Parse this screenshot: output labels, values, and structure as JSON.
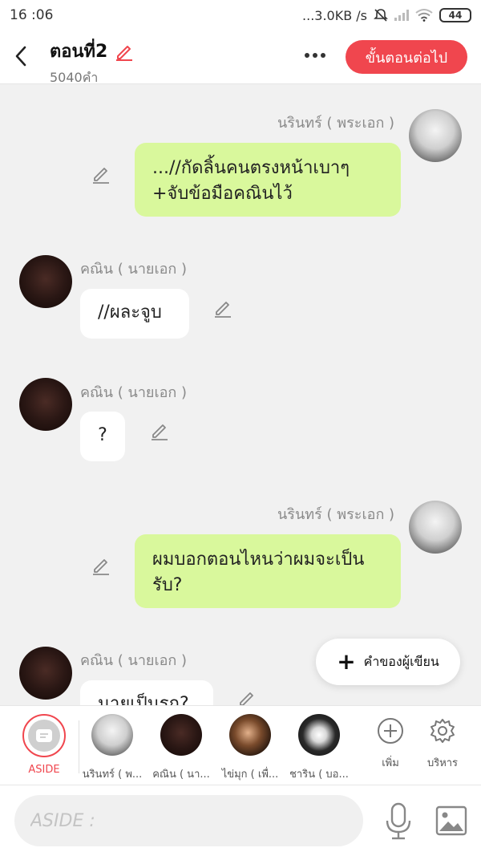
{
  "status": {
    "time": "16 :06",
    "network": "...3.0KB /s",
    "battery": "44"
  },
  "header": {
    "title": "ตอนที่2",
    "word_count": "5040คำ",
    "next_button": "ขั้นตอนต่อไป"
  },
  "messages": [
    {
      "name": "นรินทร์ ( พระเอก )",
      "text": "...//กัดลิ้นคนตรงหน้าเบาๆ +จับข้อมือคณินไว้"
    },
    {
      "name": "คณิน ( นายเอก )",
      "text": "//ผละจูบ"
    },
    {
      "name": "คณิน ( นายเอก )",
      "text": "?"
    },
    {
      "name": "นรินทร์ ( พระเอก )",
      "text": "ผมบอกตอนไหนว่าผมจะเป็นรับ?"
    },
    {
      "name": "คณิน ( นายเอก )",
      "text": "นายเป็นรุก?"
    }
  ],
  "fab": {
    "label": "คำของผู้เขียน"
  },
  "character_bar": {
    "aside_label": "ASIDE",
    "characters": [
      {
        "label": "นรินทร์ ( พ..."
      },
      {
        "label": "คณิน ( นา..."
      },
      {
        "label": "ไข่มุก ( เพื่..."
      },
      {
        "label": "ชาริน ( บอ..."
      }
    ],
    "add_label": "เพิ่ม",
    "manage_label": "บริหาร"
  },
  "input": {
    "placeholder": "ASIDE :"
  },
  "colors": {
    "accent": "#f0464e",
    "green_bubble": "#d9f89c",
    "background": "#f1f1f1"
  }
}
